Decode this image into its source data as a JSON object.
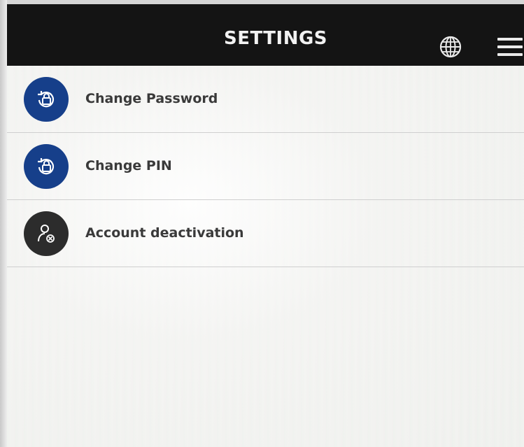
{
  "header": {
    "title": "SETTINGS",
    "globe_icon": "globe-icon",
    "menu_icon": "hamburger-menu-icon"
  },
  "colors": {
    "header_background": "#141414",
    "header_text": "#f2f2f2",
    "accent_blue": "#163f8a",
    "icon_dark": "#2c2c2c",
    "label_text": "#3a3a3a",
    "divider": "#cfcfcf"
  },
  "settings": {
    "items": [
      {
        "label": "Change Password",
        "icon": "lock-refresh-icon"
      },
      {
        "label": "Change PIN",
        "icon": "lock-refresh-icon"
      },
      {
        "label": "Account deactivation",
        "icon": "user-remove-icon"
      }
    ]
  }
}
